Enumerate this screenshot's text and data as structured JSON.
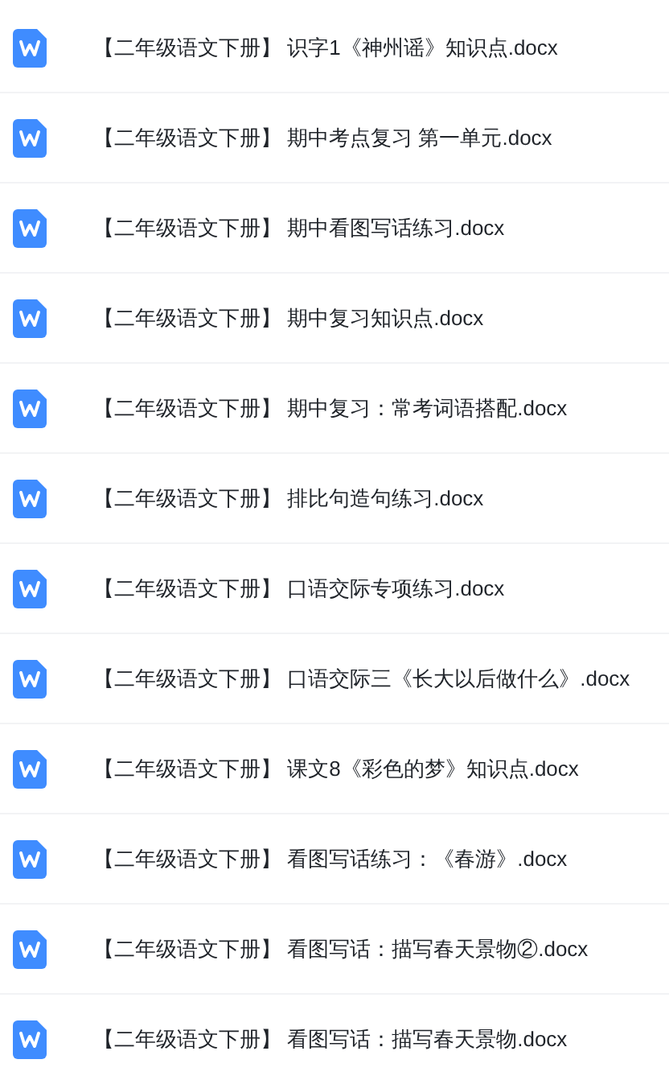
{
  "files": [
    {
      "name": "【二年级语文下册】 识字1《神州谣》知识点.docx"
    },
    {
      "name": "【二年级语文下册】 期中考点复习 第一单元.docx"
    },
    {
      "name": "【二年级语文下册】 期中看图写话练习.docx"
    },
    {
      "name": "【二年级语文下册】 期中复习知识点.docx"
    },
    {
      "name": "【二年级语文下册】 期中复习：常考词语搭配.docx"
    },
    {
      "name": "【二年级语文下册】 排比句造句练习.docx"
    },
    {
      "name": "【二年级语文下册】 口语交际专项练习.docx"
    },
    {
      "name": "【二年级语文下册】 口语交际三《长大以后做什么》.docx"
    },
    {
      "name": "【二年级语文下册】 课文8《彩色的梦》知识点.docx"
    },
    {
      "name": "【二年级语文下册】 看图写话练习：《春游》.docx"
    },
    {
      "name": "【二年级语文下册】 看图写话：描写春天景物②.docx"
    },
    {
      "name": "【二年级语文下册】 看图写话：描写春天景物.docx"
    }
  ]
}
